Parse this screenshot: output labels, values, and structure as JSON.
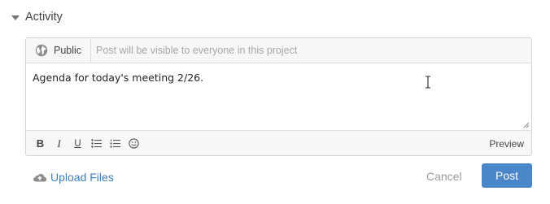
{
  "activity": {
    "title": "Activity",
    "collapse_icon": "caret-down-icon"
  },
  "composer": {
    "visibility": {
      "icon": "globe-icon",
      "label": "Public",
      "hint": "Post will be visible to everyone in this project"
    },
    "editor": {
      "text": "Agenda for today's meeting 2/26."
    },
    "toolbar": {
      "bold": "B",
      "italic": "I",
      "underline": "U",
      "bullet_list_icon": "bullet-list-icon",
      "numbered_list_icon": "numbered-list-icon",
      "emoji_icon": "smiley-icon",
      "preview": "Preview"
    }
  },
  "actions": {
    "upload": {
      "icon": "cloud-upload-icon",
      "label": "Upload Files"
    },
    "cancel": "Cancel",
    "post": "Post"
  },
  "colors": {
    "accent": "#4a86c8",
    "link": "#3f7fc0"
  }
}
